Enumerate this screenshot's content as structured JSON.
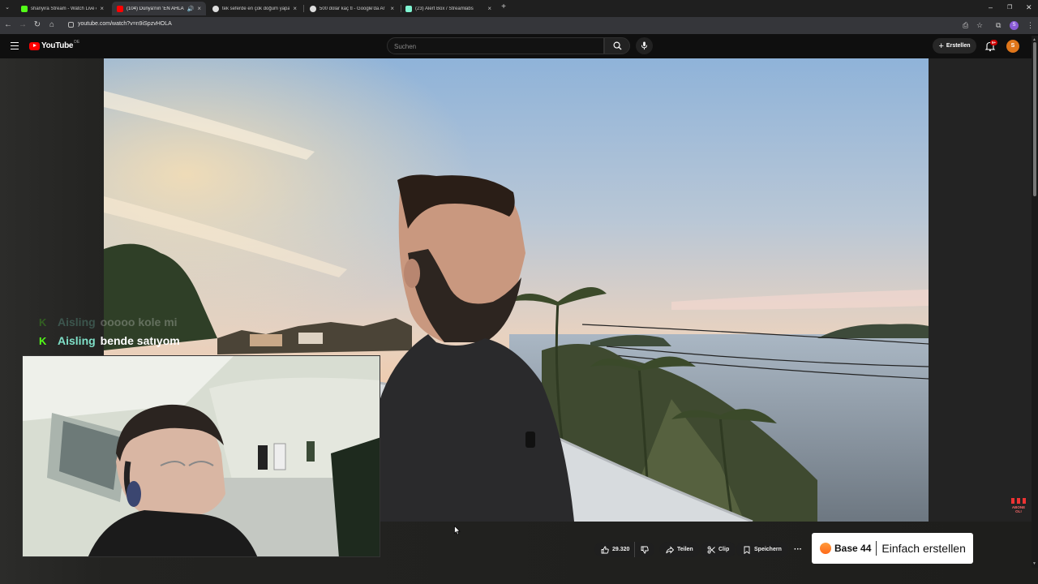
{
  "browser": {
    "tabs": [
      {
        "title": "shanyira Stream - Watch Live o",
        "favicon_color": "#53fc18",
        "active": false
      },
      {
        "title": "(104) Dünya'nın 'EN AHLAK",
        "favicon_color": "#ff0000",
        "active": true
      },
      {
        "title": "tek seferde en çok doğum yapa",
        "favicon_color": "#dddddd",
        "active": false
      },
      {
        "title": "500 dolar kaç tl - Google'da Ar",
        "favicon_color": "#dddddd",
        "active": false
      },
      {
        "title": "(23) Alert Box / Streamlabs",
        "favicon_color": "#80f5d2",
        "active": false
      }
    ],
    "url": "youtube.com/watch?v=n9iSpzvHOLA"
  },
  "youtube": {
    "logo_text": "YouTube",
    "region": "DE",
    "search_placeholder": "Suchen",
    "create_label": "Erstellen",
    "notification_badge": "9+",
    "avatar_letter": "S"
  },
  "chat": [
    {
      "user": "Aisling",
      "message": "ooooo kole mi",
      "faded": true
    },
    {
      "user": "Aisling",
      "message": "bende satıyom",
      "faded": false
    }
  ],
  "actions": {
    "likes": "29.320",
    "share_label": "Teilen",
    "clip_label": "Clip",
    "save_label": "Speichern"
  },
  "sponsor": {
    "brand": "Base 44",
    "tagline": "Einfach erstellen"
  },
  "overlay_badge": "ABONE OL!"
}
